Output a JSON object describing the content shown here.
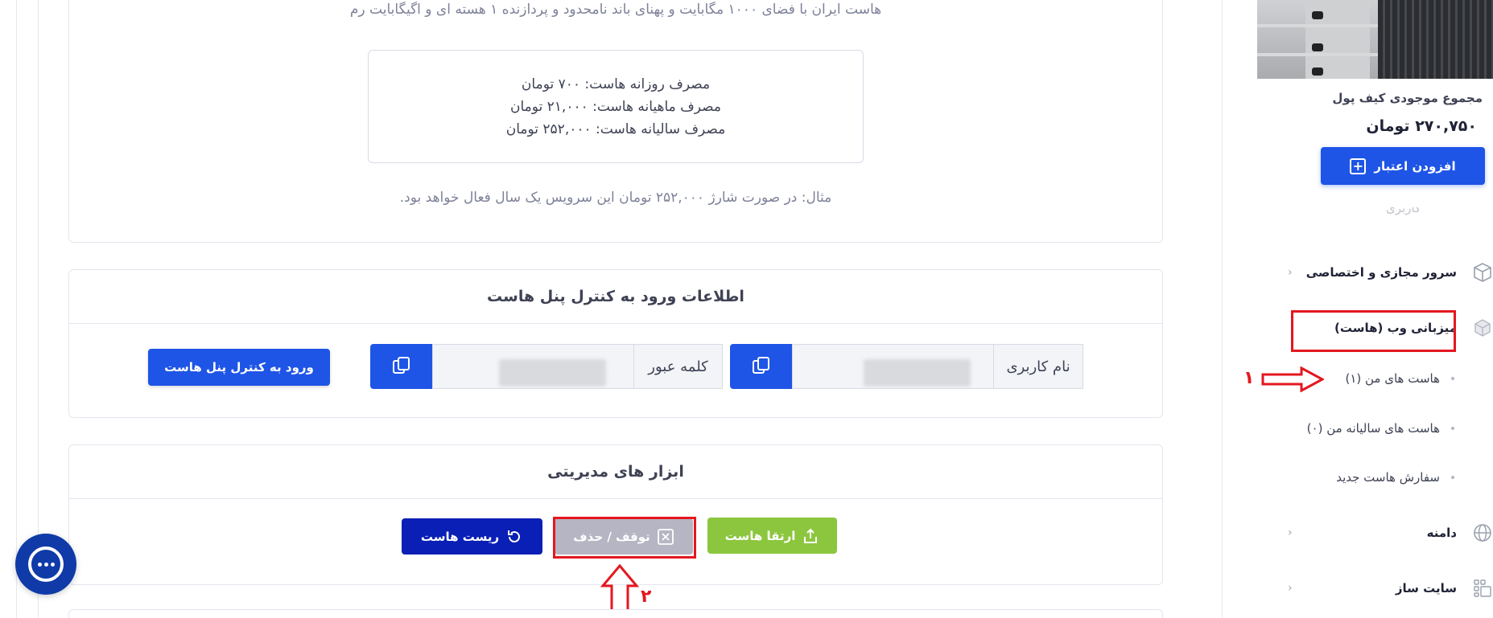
{
  "host_info": {
    "description": "هاست ایران با فضای ۱۰۰۰ مگابایت و پهنای باند نامحدود و پردازنده ۱ هسته ای و اگیگابایت رم",
    "usage_lines": [
      "مصرف روزانه هاست: ۷۰۰ تومان",
      "مصرف ماهیانه هاست: ۲۱,۰۰۰ تومان",
      "مصرف سالیانه هاست: ۲۵۲,۰۰۰ تومان"
    ],
    "example": "مثال: در صورت شارژ ۲۵۲,۰۰۰ تومان این سرویس یک سال فعال خواهد بود."
  },
  "login_card": {
    "title": "اطلاعات ورود به کنترل پنل هاست",
    "username_label": "نام کاربری",
    "password_label": "کلمه عبور",
    "login_button": "ورود به کنترل پنل هاست"
  },
  "tools_card": {
    "title": "ابزار های مدیریتی",
    "upgrade_button": "ارتقا هاست",
    "stop_button": "توقف / حذف",
    "reset_button": "ریست هاست"
  },
  "sidebar": {
    "wallet_title": "مجموع موجودی کیف پول",
    "wallet_amount": "۲۷۰,۷۵۰ تومان",
    "add_credit_button": "افزودن اعتبار",
    "faded_item": "کاربری",
    "nav": [
      {
        "label": "سرور مجازی و اختصاصی",
        "icon": "cube-icon"
      },
      {
        "label": "میزبانی وب (هاست)",
        "icon": "box-icon"
      },
      {
        "label": "دامنه",
        "icon": "globe-icon"
      },
      {
        "label": "سایت ساز",
        "icon": "grid-icon"
      }
    ],
    "sub_items": [
      {
        "label": "هاست های من (۱)"
      },
      {
        "label": "هاست های سالیانه من (۰)"
      },
      {
        "label": "سفارش هاست جدید"
      }
    ]
  },
  "annotations": {
    "marker_1": "۱",
    "marker_2": "۲"
  },
  "colors": {
    "primary": "#1e55e6",
    "upgrade": "#8cc63f",
    "stop": "#b5b5c3",
    "reset": "#0a1fb5",
    "annotation": "#e4171f"
  }
}
